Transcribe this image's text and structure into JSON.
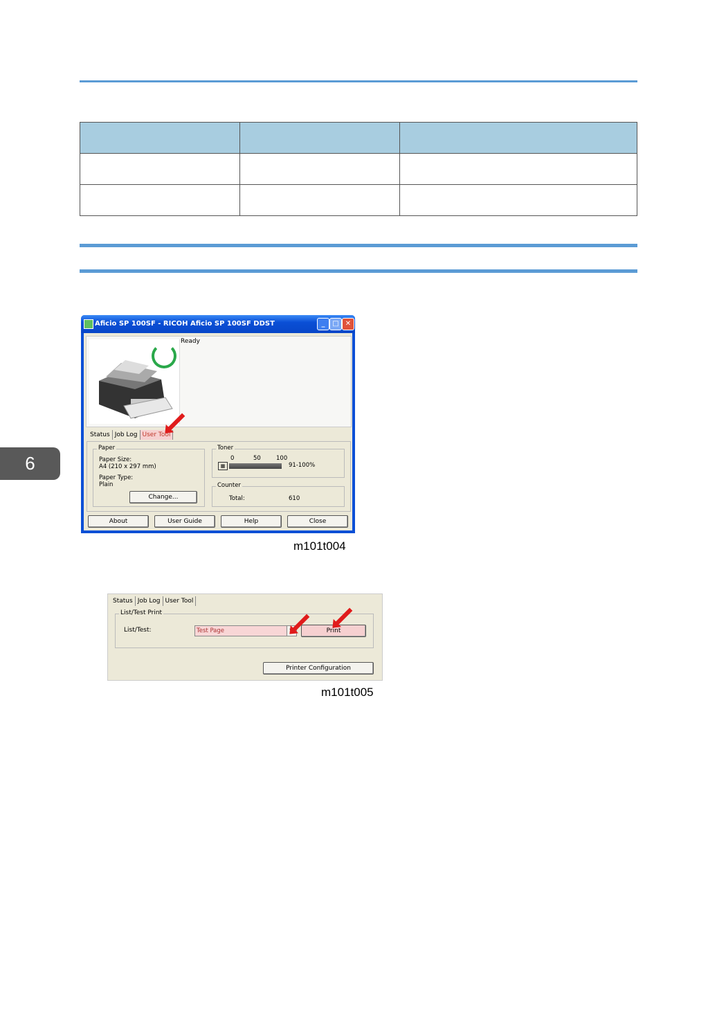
{
  "chapter": {
    "number": "6"
  },
  "table": {
    "rows": [
      [
        "",
        "",
        ""
      ],
      [
        "",
        "",
        ""
      ]
    ],
    "headers": [
      "",
      "",
      ""
    ]
  },
  "window1": {
    "title": "Aficio SP 100SF - RICOH Aficio SP 100SF DDST",
    "status_text": "Ready",
    "tabs": [
      "Status",
      "Job Log",
      "User Tool"
    ],
    "paper": {
      "group_title": "Paper",
      "size_label": "Paper Size:",
      "size_value": "A4 (210 x 297 mm)",
      "type_label": "Paper Type:",
      "type_value": "Plain",
      "change_button": "Change..."
    },
    "toner": {
      "group_title": "Toner",
      "ticks": [
        "0",
        "50",
        "100"
      ],
      "level_text": "91-100%",
      "level_fraction": 0.95
    },
    "counter": {
      "group_title": "Counter",
      "total_label": "Total:",
      "total_value": "610"
    },
    "buttons": [
      "About",
      "User Guide",
      "Help",
      "Close"
    ],
    "caption": "m101t004"
  },
  "window2": {
    "tabs": [
      "Status",
      "Job Log",
      "User Tool"
    ],
    "group_title": "List/Test Print",
    "list_label": "List/Test:",
    "list_value": "Test Page",
    "print_button": "Print",
    "config_button": "Printer Configuration",
    "caption": "m101t005"
  },
  "colors": {
    "accent_rule": "#5b9bd5",
    "table_header": "#a8cde0",
    "chapter_tab": "#595959",
    "arrow": "#e01b1b"
  }
}
